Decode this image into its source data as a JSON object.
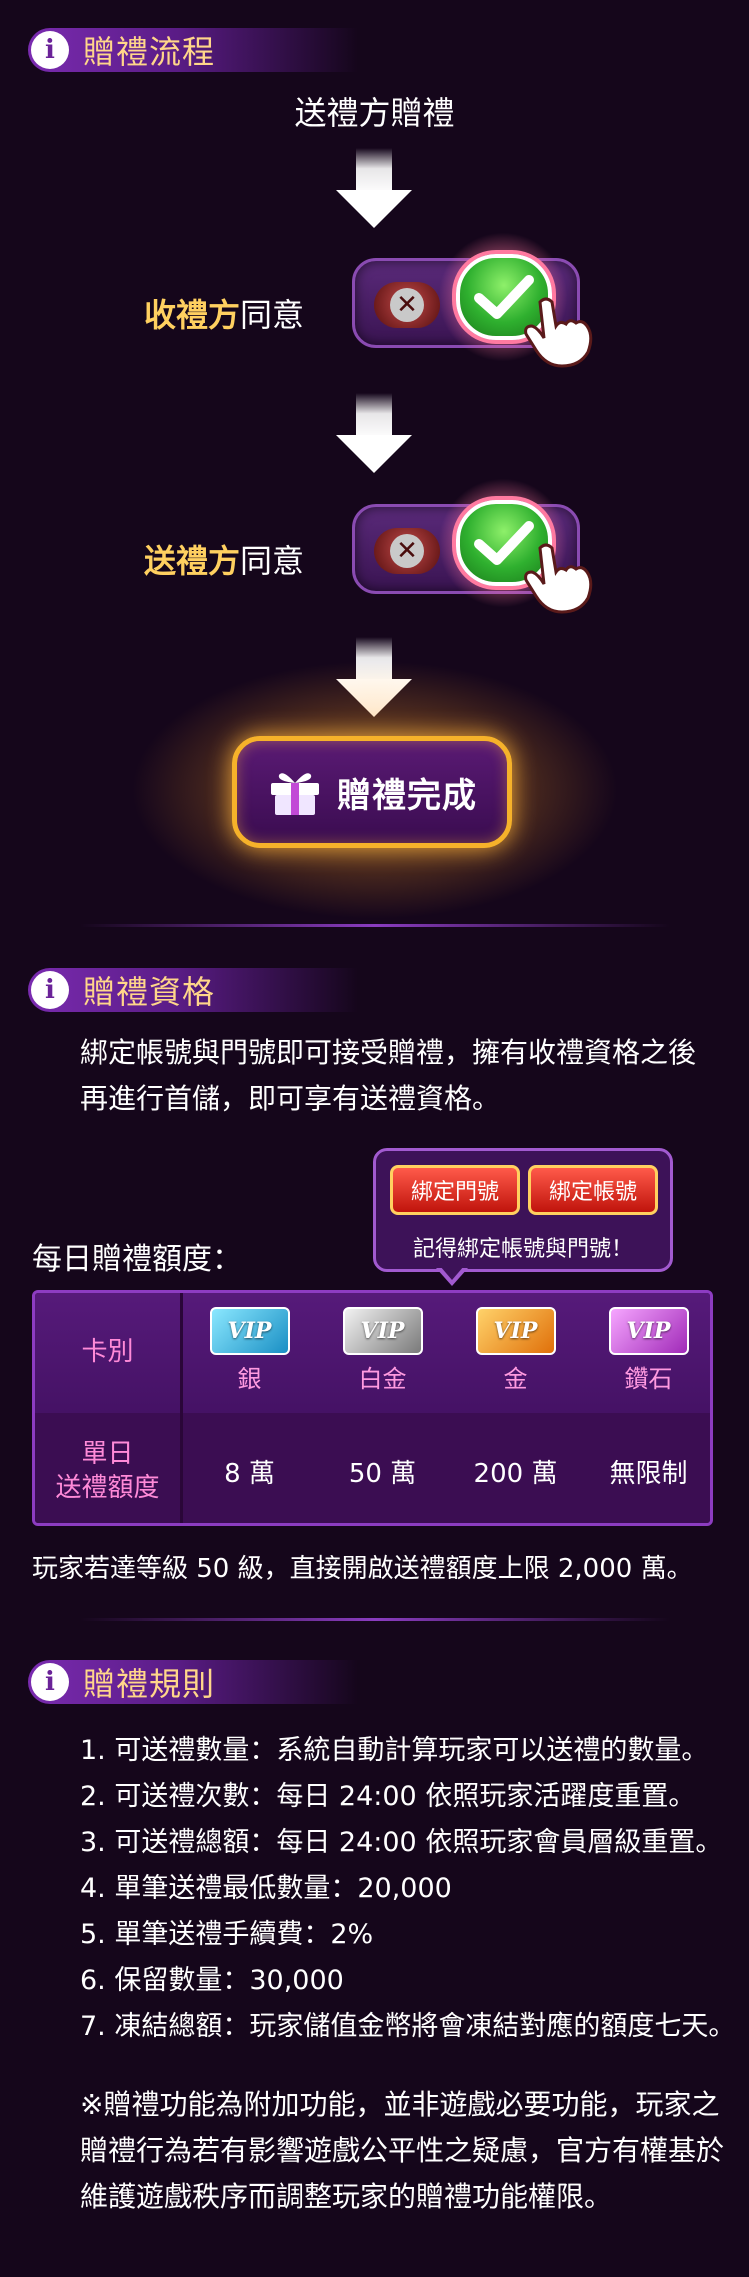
{
  "flow": {
    "section_title": "贈禮流程",
    "step_sender_gift": "送禮方贈禮",
    "receiver_label_highlight": "收禮方",
    "receiver_label_rest": "同意",
    "sender_label_highlight": "送禮方",
    "sender_label_rest": "同意",
    "complete_label": "贈禮完成"
  },
  "qualification": {
    "section_title": "贈禮資格",
    "line1": "綁定帳號與門號即可接受贈禮，擁有收禮資格之後",
    "line2": "再進行首儲，即可享有送禮資格。",
    "tooltip": {
      "bind_phone_button": "綁定門號",
      "bind_account_button": "綁定帳號",
      "reminder": "記得綁定帳號與門號！"
    },
    "daily_limit_label": "每日贈禮額度：",
    "table": {
      "header_tier": "卡別",
      "header_limit_line1": "單日",
      "header_limit_line2": "送禮額度",
      "tiers": [
        {
          "badge": "VIP",
          "name": "銀",
          "limit": "8 萬",
          "color": "#2aa9d6"
        },
        {
          "badge": "VIP",
          "name": "白金",
          "limit": "50 萬",
          "color": "#8a8a8a"
        },
        {
          "badge": "VIP",
          "name": "金",
          "limit": "200 萬",
          "color": "#f08a1a"
        },
        {
          "badge": "VIP",
          "name": "鑽石",
          "limit": "無限制",
          "color": "#c24ad6"
        }
      ]
    },
    "note": "玩家若達等級 50 級，直接開啟送禮額度上限 2,000 萬。"
  },
  "rules": {
    "section_title": "贈禮規則",
    "items": [
      "1. 可送禮數量：系統自動計算玩家可以送禮的數量。",
      "2. 可送禮次數：每日 24:00 依照玩家活躍度重置。",
      "3. 可送禮總額：每日 24:00 依照玩家會員層級重置。",
      "4. 單筆送禮最低數量：20,000",
      "5. 單筆送禮手續費：2%",
      "6. 保留數量：30,000",
      "7. 凍結總額：玩家儲值金幣將會凍結對應的額度七天。"
    ],
    "disclaimer_line1": "※贈禮功能為附加功能，並非遊戲必要功能，玩家之",
    "disclaimer_line2": "贈禮行為若有影響遊戲公平性之疑慮，官方有權基於",
    "disclaimer_line3": "維護遊戲秩序而調整玩家的贈禮功能權限。"
  }
}
